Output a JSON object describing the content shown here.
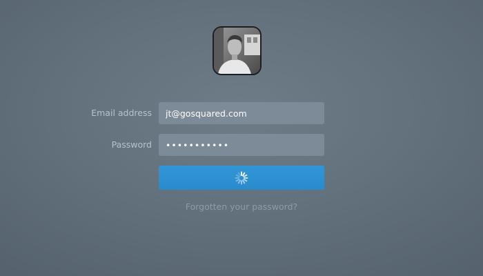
{
  "profile": {
    "avatar": "user-photo"
  },
  "login_form": {
    "email_label": "Email address",
    "email_value": "jt@gosquared.com",
    "password_label": "Password",
    "password_value": "•••••••••••",
    "submit_state": "loading",
    "submit_icon": "spinner-icon",
    "forgot_link": "Forgotten your password?"
  },
  "colors": {
    "background": "#64727e",
    "input_background": "#7d8a97",
    "button": "#2f93d4",
    "label_text": "#b9c2ca",
    "link_text": "#8f9ca7"
  }
}
